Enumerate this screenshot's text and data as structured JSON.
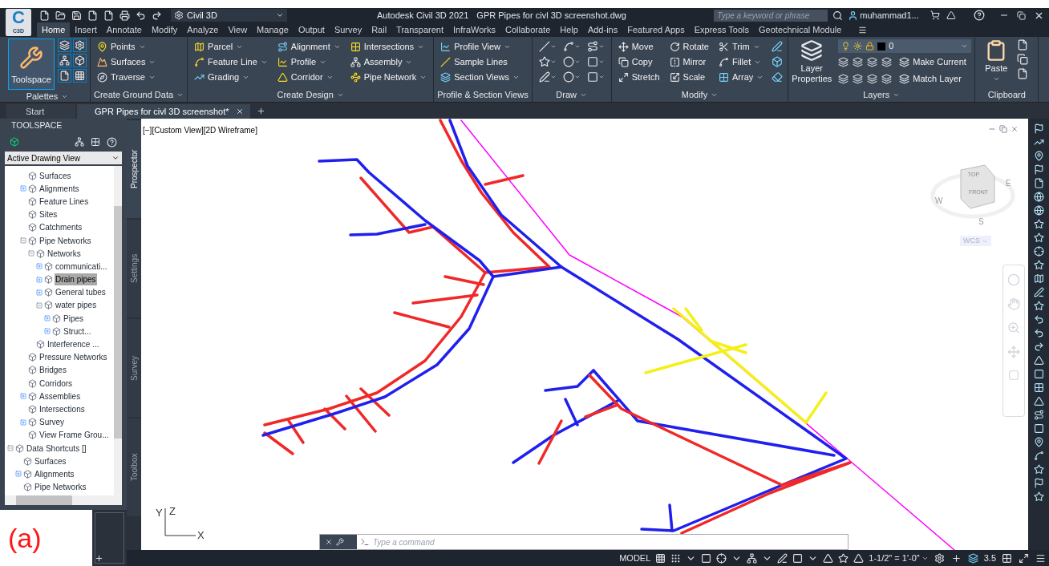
{
  "title_bar": {
    "app_logo": "C",
    "app_button": "C3D",
    "workspace": "Civil 3D",
    "app_title": "Autodesk Civil 3D 2021",
    "file_name": "GPR Pipes for civl 3D screenshot.dwg",
    "search": {
      "placeholder": "Type a keyword or phrase"
    },
    "user": "muhammad1..."
  },
  "ribbon_tabs": [
    {
      "label": "Home",
      "selected": true
    },
    {
      "label": "Insert",
      "selected": false
    },
    {
      "label": "Annotate",
      "selected": false
    },
    {
      "label": "Modify",
      "selected": false
    },
    {
      "label": "Analyze",
      "selected": false
    },
    {
      "label": "View",
      "selected": false
    },
    {
      "label": "Manage",
      "selected": false
    },
    {
      "label": "Output",
      "selected": false
    },
    {
      "label": "Survey",
      "selected": false
    },
    {
      "label": "Rail",
      "selected": false
    },
    {
      "label": "Transparent",
      "selected": false
    },
    {
      "label": "InfraWorks",
      "selected": false
    },
    {
      "label": "Collaborate",
      "selected": false
    },
    {
      "label": "Help",
      "selected": false
    },
    {
      "label": "Add-ins",
      "selected": false
    },
    {
      "label": "Featured Apps",
      "selected": false
    },
    {
      "label": "Express Tools",
      "selected": false
    },
    {
      "label": "Geotechnical Module",
      "selected": false
    }
  ],
  "ribbon_panels": [
    {
      "kind": "toolspace",
      "title": "Palettes",
      "dropdown": true,
      "items": [
        {
          "label": "Toolspace"
        }
      ]
    },
    {
      "kind": "tools",
      "title": "Create Ground Data",
      "dropdown": true,
      "items": [
        {
          "label": "Points",
          "dropdown": true
        },
        {
          "label": "Surfaces",
          "dropdown": true
        },
        {
          "label": "Traverse",
          "dropdown": true
        }
      ]
    },
    {
      "kind": "tools",
      "title": "Create Design",
      "dropdown": true,
      "items": [
        {
          "label": "Parcel",
          "dropdown": true
        },
        {
          "label": "Feature Line",
          "dropdown": true
        },
        {
          "label": "Grading",
          "dropdown": true
        },
        {
          "label": "Alignment",
          "dropdown": true
        },
        {
          "label": "Profile",
          "dropdown": true
        },
        {
          "label": "Corridor",
          "dropdown": true
        },
        {
          "label": "Intersections",
          "dropdown": true
        },
        {
          "label": "Assembly",
          "dropdown": true
        },
        {
          "label": "Pipe Network",
          "dropdown": true
        }
      ]
    },
    {
      "kind": "tools",
      "title": "Profile & Section Views",
      "dropdown": false,
      "items": [
        {
          "label": "Profile View",
          "dropdown": true
        },
        {
          "label": "Sample Lines",
          "dropdown": false
        },
        {
          "label": "Section Views",
          "dropdown": true
        }
      ]
    },
    {
      "kind": "draw",
      "title": "Draw",
      "dropdown": true
    },
    {
      "kind": "tools",
      "title": "Modify",
      "dropdown": true,
      "items": [
        {
          "label": "Move",
          "dropdown": false
        },
        {
          "label": "Copy",
          "dropdown": false
        },
        {
          "label": "Stretch",
          "dropdown": false
        },
        {
          "label": "Rotate",
          "dropdown": false
        },
        {
          "label": "Mirror",
          "dropdown": false
        },
        {
          "label": "Scale",
          "dropdown": false
        },
        {
          "label": "Trim",
          "dropdown": true
        },
        {
          "label": "Fillet",
          "dropdown": true
        },
        {
          "label": "Array",
          "dropdown": true
        }
      ]
    },
    {
      "kind": "layers",
      "title": "Layers",
      "dropdown": true,
      "items": [
        {
          "label": "Layer Properties"
        },
        {
          "label": "0",
          "dropdown": true
        },
        {
          "label": "Make Current",
          "dropdown": false
        },
        {
          "label": "Match Layer",
          "dropdown": false
        }
      ]
    },
    {
      "kind": "paste",
      "title": "Clipboard",
      "dropdown": false,
      "items": [
        {
          "label": "Paste",
          "dropdown": true
        }
      ]
    }
  ],
  "doc_tabs": [
    {
      "label": "Start",
      "selected": false,
      "closable": false
    },
    {
      "label": "GPR Pipes for civl 3D screenshot*",
      "selected": true,
      "closable": true
    }
  ],
  "toolspace": {
    "title": "TOOLSPACE",
    "view_select": "Active Drawing View",
    "tree": [
      {
        "children": [
          {
            "label": "Surfaces",
            "selected": false
          },
          {
            "label": "Alignments",
            "selected": false,
            "expanded": false
          },
          {
            "label": "Feature Lines",
            "selected": false
          },
          {
            "label": "Sites",
            "selected": false
          },
          {
            "label": "Catchments",
            "selected": false
          },
          {
            "label": "Pipe Networks",
            "selected": false,
            "expanded": true,
            "children": [
              {
                "label": "Networks",
                "selected": false,
                "expanded": true,
                "children": [
                  {
                    "label": "communicati...",
                    "selected": false,
                    "expanded": false
                  },
                  {
                    "label": "Drain pipes",
                    "selected": true,
                    "expanded": false
                  },
                  {
                    "label": "General tubes",
                    "selected": false,
                    "expanded": false
                  },
                  {
                    "label": "water pipes",
                    "selected": false,
                    "expanded": true,
                    "children": [
                      {
                        "label": "Pipes",
                        "selected": false,
                        "expanded": false
                      },
                      {
                        "label": "Struct...",
                        "selected": false,
                        "expanded": false
                      }
                    ]
                  }
                ]
              },
              {
                "label": "Interference ...",
                "selected": false
              }
            ]
          },
          {
            "label": "Pressure Networks",
            "selected": false
          },
          {
            "label": "Bridges",
            "selected": false
          },
          {
            "label": "Corridors",
            "selected": false
          },
          {
            "label": "Assemblies",
            "selected": false,
            "expanded": false
          },
          {
            "label": "Intersections",
            "selected": false
          },
          {
            "label": "Survey",
            "selected": false,
            "expanded": false
          },
          {
            "label": "View Frame Grou...",
            "selected": false
          }
        ]
      },
      {
        "label": "Data Shortcuts []",
        "selected": false,
        "expanded": true,
        "children": [
          {
            "label": "Surfaces",
            "selected": false
          },
          {
            "label": "Alignments",
            "selected": false,
            "expanded": false
          },
          {
            "label": "Pipe Networks",
            "selected": false
          }
        ]
      }
    ],
    "side_tabs": [
      {
        "label": "Prospector",
        "selected": true
      },
      {
        "label": "Settings",
        "selected": false
      },
      {
        "label": "Survey",
        "selected": false
      },
      {
        "label": "Toolbox",
        "selected": false
      }
    ]
  },
  "viewport": {
    "view_label": "[−][Custom View][2D Wireframe]",
    "viewcube": {
      "top": "TOP",
      "front": "FRONT",
      "west": "W",
      "east": "E",
      "south": "S",
      "ucs_menu": "WCS"
    },
    "ucs_axes": {
      "x": "X",
      "y": "Y",
      "z": "Z"
    },
    "command_line": {
      "placeholder": "Type a command"
    }
  },
  "figure_label": "(a)",
  "status_bar": {
    "space": "MODEL",
    "annotation_scale": "1-1/2\" = 1'-0\"",
    "value": "3.5"
  }
}
